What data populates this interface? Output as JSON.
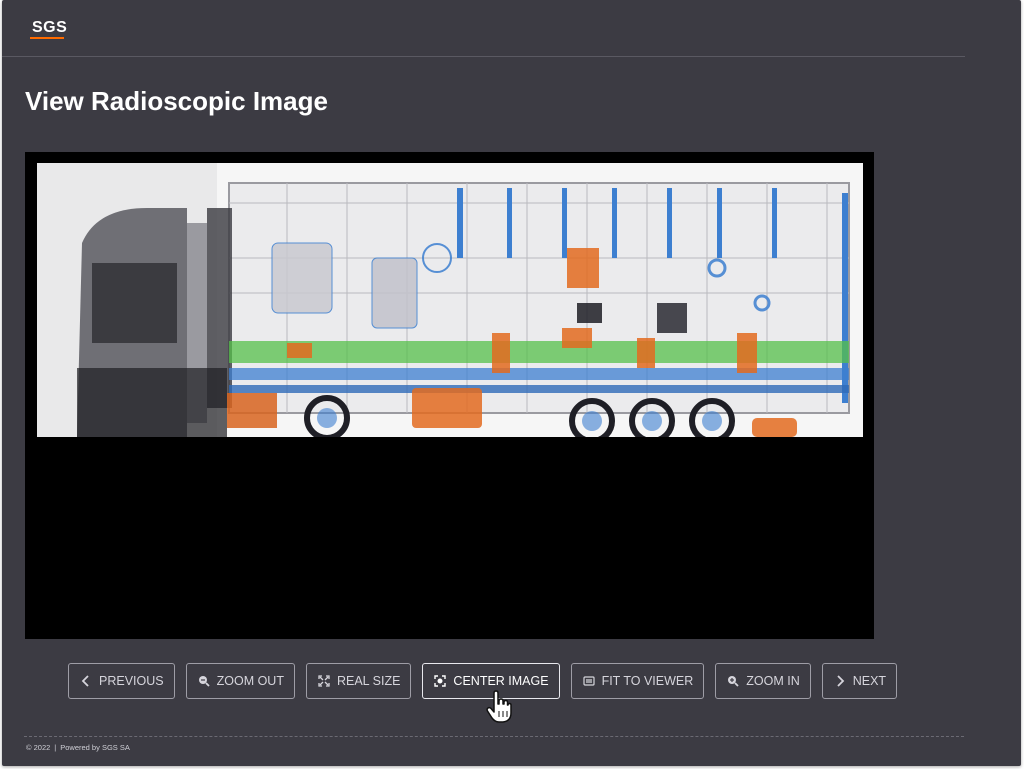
{
  "app": {
    "logo_text": "SGS"
  },
  "page": {
    "title": "View Radioscopic Image"
  },
  "viewer": {
    "image_alt": "X-ray scan of truck with trailer"
  },
  "toolbar": {
    "previous": "PREVIOUS",
    "zoom_out": "ZOOM OUT",
    "real_size": "REAL SIZE",
    "center_image": "CENTER IMAGE",
    "fit_to_viewer": "FIT TO VIEWER",
    "zoom_in": "ZOOM IN",
    "next": "NEXT"
  },
  "footer": {
    "copyright": "© 2022",
    "powered_by": "Powered by SGS SA"
  },
  "colors": {
    "background": "#3c3b43",
    "viewer_bg": "#000000",
    "accent": "#ff6b00"
  }
}
